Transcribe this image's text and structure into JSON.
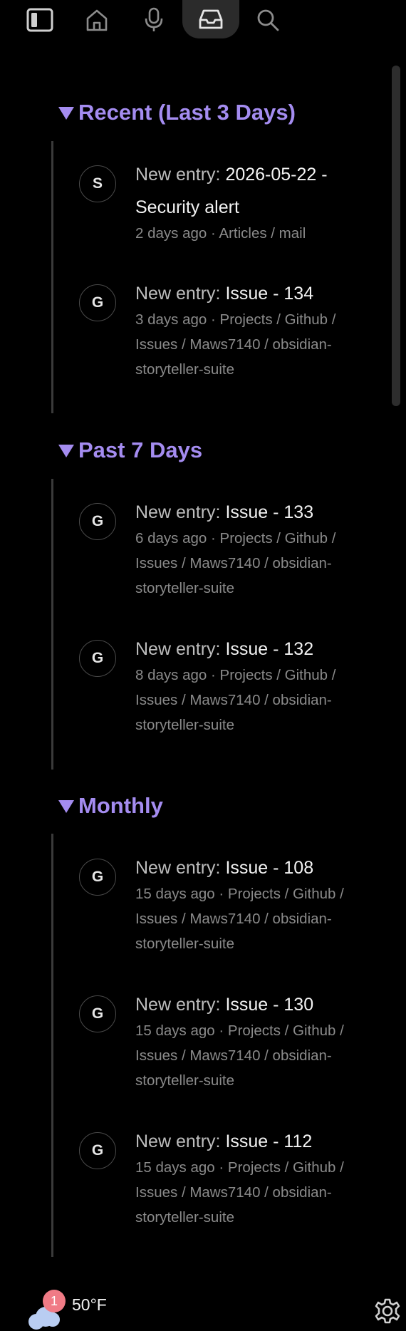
{
  "toolbar": {
    "buttons": [
      {
        "name": "sidebar-toggle",
        "icon": "sidebar-toggle-icon"
      },
      {
        "name": "home",
        "icon": "home-icon"
      },
      {
        "name": "microphone",
        "icon": "microphone-icon"
      },
      {
        "name": "inbox",
        "icon": "inbox-icon",
        "active": true
      },
      {
        "name": "search",
        "icon": "search-icon"
      }
    ]
  },
  "sections": [
    {
      "title": "Recent (Last 3 Days)",
      "entries": [
        {
          "avatar": "S",
          "prefix": "New entry: ",
          "title": "2026-05-22 - Security alert",
          "meta": "2 days ago · Articles / mail"
        },
        {
          "avatar": "G",
          "prefix": "New entry: ",
          "title": "Issue - 134",
          "meta": "3 days ago · Projects / Github / Issues / Maws7140 / obsidian-storyteller-suite"
        }
      ]
    },
    {
      "title": "Past 7 Days",
      "entries": [
        {
          "avatar": "G",
          "prefix": "New entry: ",
          "title": "Issue - 133",
          "meta": "6 days ago · Projects / Github / Issues / Maws7140 / obsidian-storyteller-suite"
        },
        {
          "avatar": "G",
          "prefix": "New entry: ",
          "title": "Issue - 132",
          "meta": "8 days ago · Projects / Github / Issues / Maws7140 / obsidian-storyteller-suite"
        }
      ]
    },
    {
      "title": "Monthly",
      "entries": [
        {
          "avatar": "G",
          "prefix": "New entry: ",
          "title": "Issue - 108",
          "meta": "15 days ago · Projects / Github / Issues / Maws7140 / obsidian-storyteller-suite"
        },
        {
          "avatar": "G",
          "prefix": "New entry: ",
          "title": "Issue - 130",
          "meta": "15 days ago · Projects / Github / Issues / Maws7140 / obsidian-storyteller-suite"
        },
        {
          "avatar": "G",
          "prefix": "New entry: ",
          "title": "Issue - 112",
          "meta": "15 days ago · Projects / Github / Issues / Maws7140 / obsidian-storyteller-suite"
        }
      ]
    }
  ],
  "footer": {
    "weather_badge": "1",
    "temperature": "50°F",
    "weather_icon": "cloud-icon",
    "settings_icon": "gear-icon"
  },
  "colors": {
    "accent": "#a48cf0",
    "background": "#000000",
    "badge": "#f07b86"
  }
}
